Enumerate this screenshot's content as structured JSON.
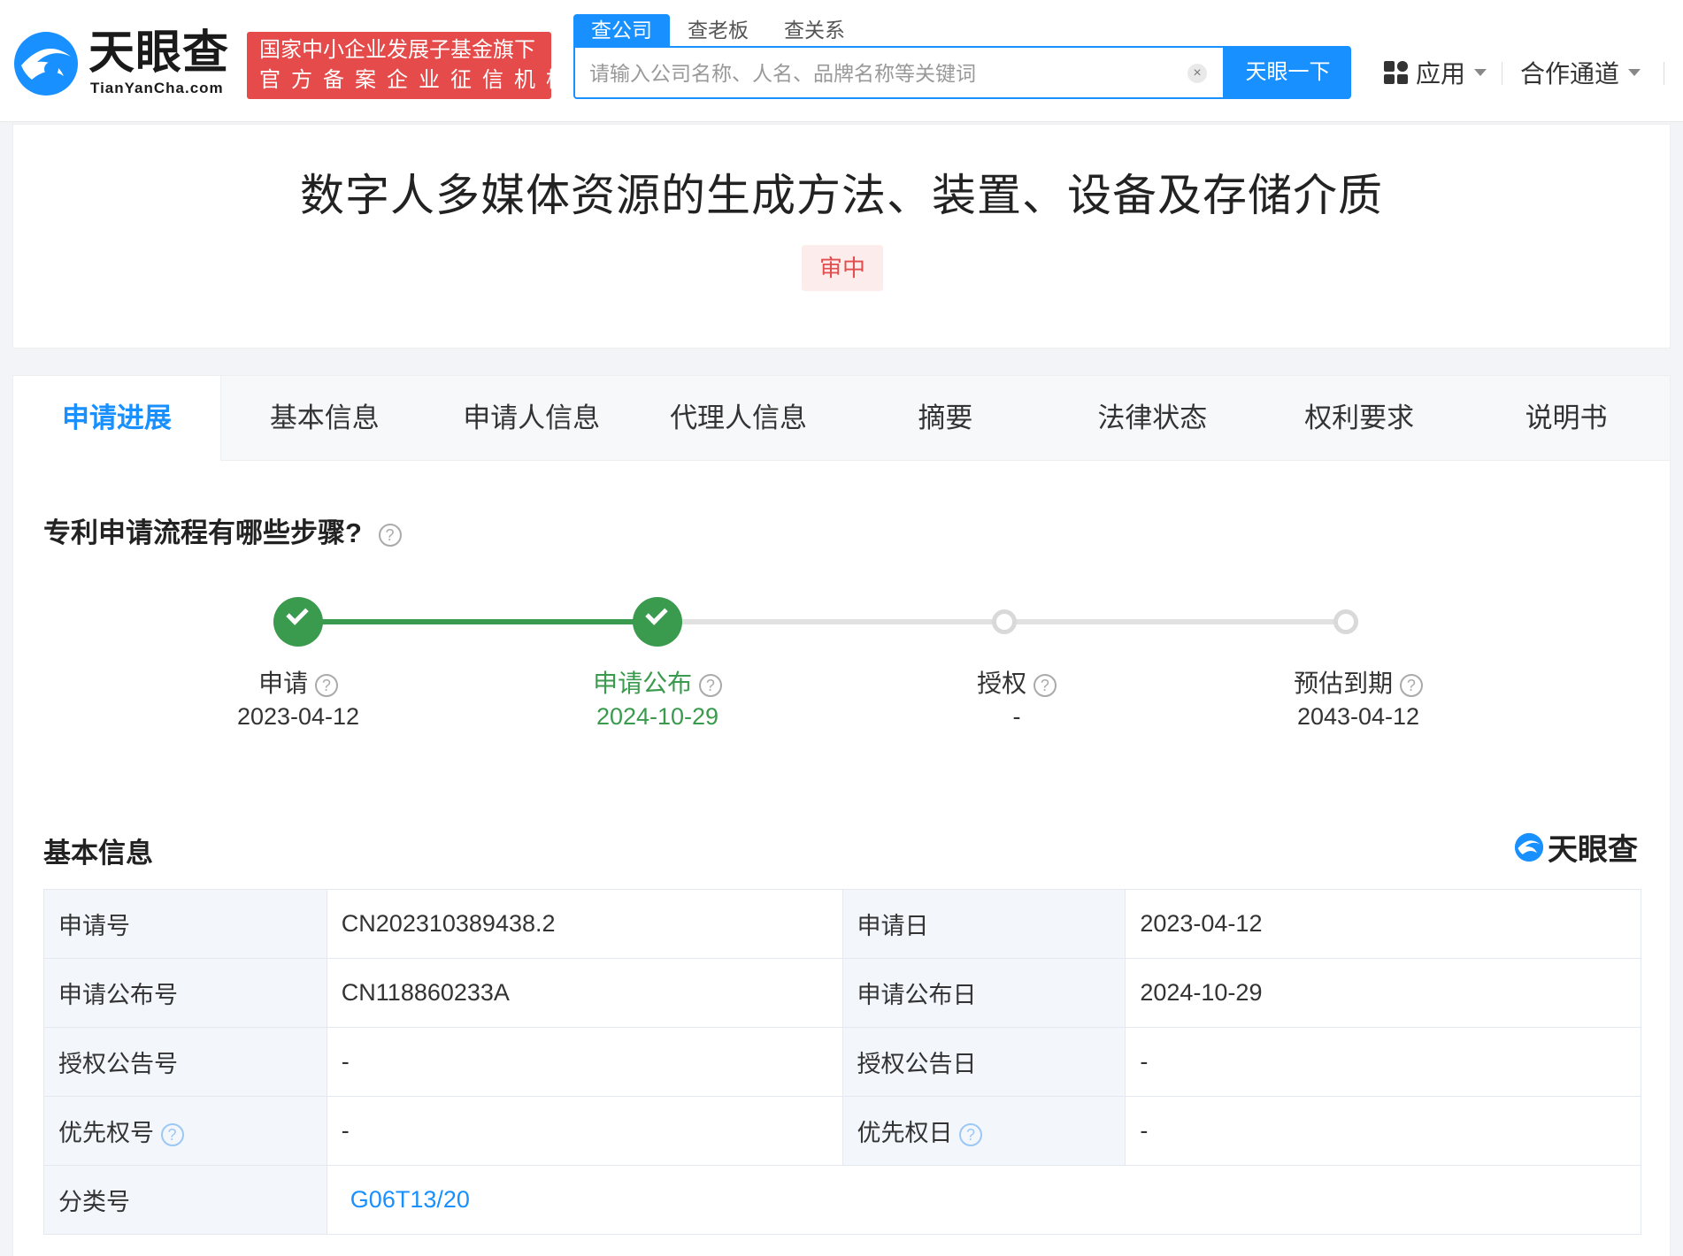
{
  "header": {
    "logo_cn": "天眼查",
    "logo_en": "TianYanCha.com",
    "fund_line1": "国家中小企业发展子基金旗下",
    "fund_line2": "官方备案企业征信机构",
    "search_tabs": [
      "查公司",
      "查老板",
      "查关系"
    ],
    "search_placeholder": "请输入公司名称、人名、品牌名称等关键词",
    "search_button": "天眼一下",
    "nav_apps": "应用",
    "nav_coop": "合作通道"
  },
  "patent": {
    "title": "数字人多媒体资源的生成方法、装置、设备及存储介质",
    "status": "审中"
  },
  "tabs": [
    "申请进展",
    "基本信息",
    "申请人信息",
    "代理人信息",
    "摘要",
    "法律状态",
    "权利要求",
    "说明书"
  ],
  "progress": {
    "title": "专利申请流程有哪些步骤?",
    "current_step": 2,
    "steps": [
      {
        "label": "申请",
        "date": "2023-04-12",
        "state": "done"
      },
      {
        "label": "申请公布",
        "date": "2024-10-29",
        "state": "done"
      },
      {
        "label": "授权",
        "date": "-",
        "state": "todo"
      },
      {
        "label": "预估到期",
        "date": "2043-04-12",
        "state": "todo"
      }
    ]
  },
  "basic_info": {
    "title": "基本信息",
    "brand": "天眼查",
    "rows": [
      {
        "k1": "申请号",
        "v1": "CN202310389438.2",
        "k2": "申请日",
        "v2": "2023-04-12"
      },
      {
        "k1": "申请公布号",
        "v1": "CN118860233A",
        "k2": "申请公布日",
        "v2": "2024-10-29"
      },
      {
        "k1": "授权公告号",
        "v1": "-",
        "k2": "授权公告日",
        "v2": "-"
      },
      {
        "k1": "优先权号",
        "v1": "-",
        "k2": "优先权日",
        "v2": "-"
      }
    ],
    "classification_label": "分类号",
    "classification_value": "G06T13/20"
  },
  "colors": {
    "brand_blue": "#1890ff",
    "done_green": "#3a9a4d",
    "status_red": "#e24d4d"
  }
}
